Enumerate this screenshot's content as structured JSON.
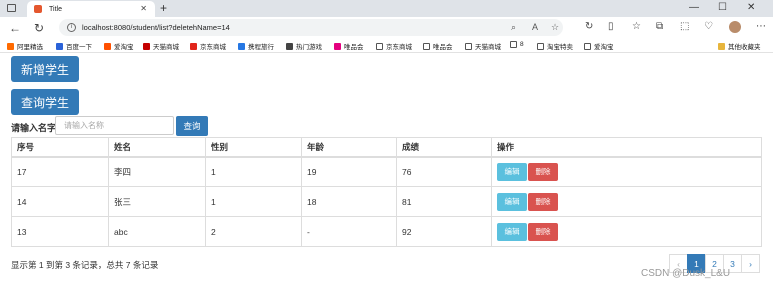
{
  "browser": {
    "tab_title": "Title",
    "tab_close": "✕",
    "new_tab": "+",
    "url": "localhost:8080/student/list?deletehName=14",
    "back": "←",
    "refresh": "↻",
    "min": "—",
    "max": "☐",
    "close": "✕"
  },
  "bookmarks": [
    {
      "label": "阿里精选",
      "color": "#ff6a00"
    },
    {
      "label": "百度一下",
      "color": "#2a62d8"
    },
    {
      "label": "爱淘宝",
      "color": "#ff5000"
    },
    {
      "label": "天猫商城",
      "color": "#c40000"
    },
    {
      "label": "京东商城",
      "color": "#e1251b"
    },
    {
      "label": "携程旅行",
      "color": "#2577e3"
    },
    {
      "label": "热门游戏",
      "color": "#444444"
    },
    {
      "label": "唯品会",
      "color": "#e4007f"
    },
    {
      "label": "京东商城",
      "color": "doc"
    },
    {
      "label": "唯品会",
      "color": "doc"
    },
    {
      "label": "天猫商城",
      "color": "doc"
    },
    {
      "label": "8",
      "color": "doc"
    },
    {
      "label": "淘宝特卖",
      "color": "doc"
    },
    {
      "label": "爱淘宝",
      "color": "doc"
    }
  ],
  "bookmarks_other": "其他收藏夹",
  "page": {
    "add_button": "新增学生",
    "query_button": "查询学生",
    "search_label": "请输入名字",
    "search_placeholder": "请输入名称",
    "search_button": "查询"
  },
  "table": {
    "headers": [
      "序号",
      "姓名",
      "性别",
      "年龄",
      "成绩",
      "操作"
    ],
    "rows": [
      {
        "id": "17",
        "name": "李四",
        "gender": "1",
        "age": "19",
        "score": "76"
      },
      {
        "id": "14",
        "name": "张三",
        "gender": "1",
        "age": "18",
        "score": "81"
      },
      {
        "id": "13",
        "name": "abc",
        "gender": "2",
        "age": "-",
        "score": "92"
      }
    ],
    "edit_label": "编辑",
    "delete_label": "删除"
  },
  "summary": "显示第 1 到第 3 条记录，总共 7 条记录",
  "pagination": {
    "prev": "‹",
    "pages": [
      "1",
      "2",
      "3"
    ],
    "next": "›",
    "current": "1"
  },
  "watermark": "CSDN @Dusk_L&U",
  "colors": {
    "primary": "#337ab7",
    "info": "#5bc0de",
    "danger": "#d9534f"
  }
}
